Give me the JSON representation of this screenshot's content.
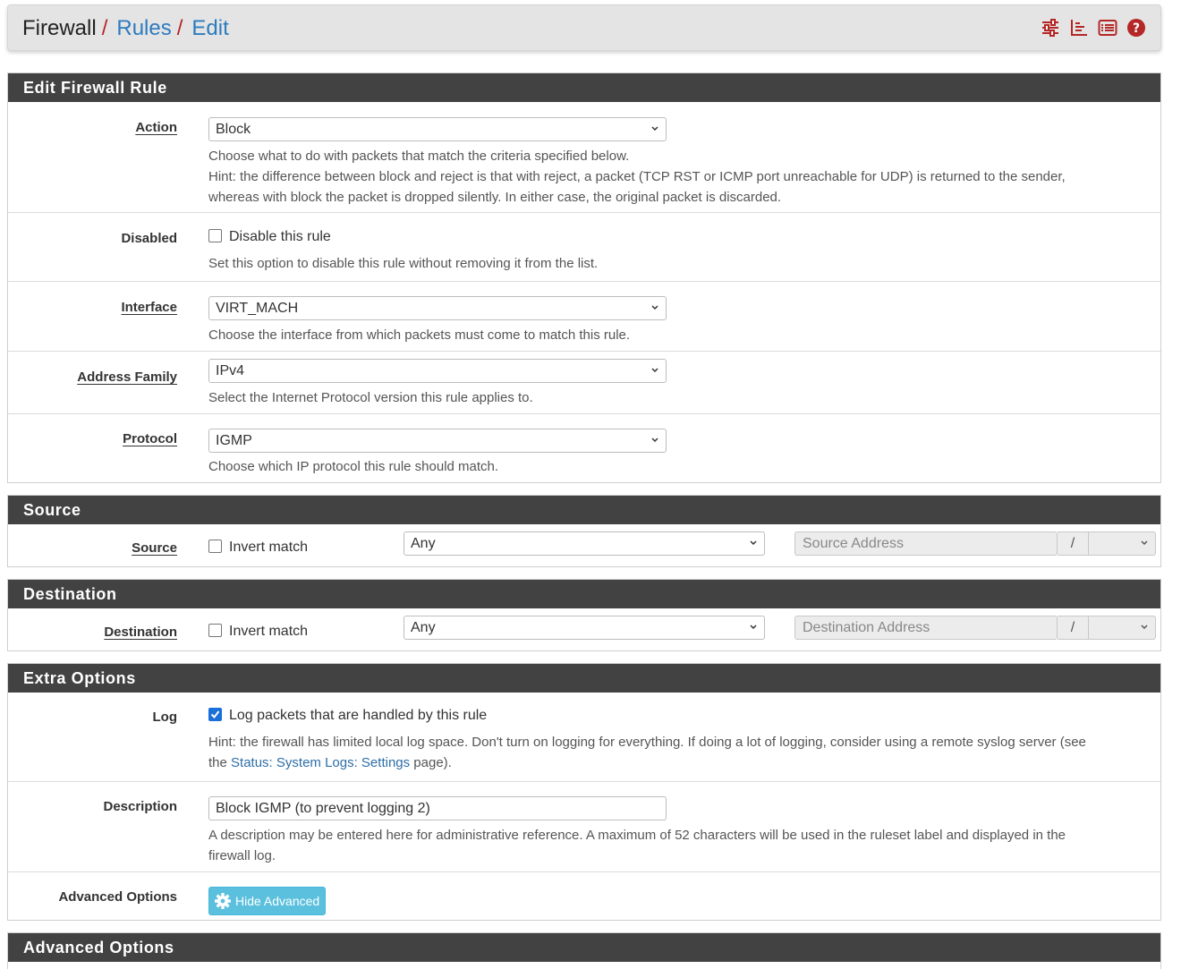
{
  "breadcrumb": {
    "root": "Firewall",
    "sep": "/",
    "level2": "Rules",
    "level3": "Edit"
  },
  "header_icons": [
    "sliders-icon",
    "chart-icon",
    "list-icon",
    "help-icon"
  ],
  "colors": {
    "accent_red": "#b52626",
    "link_blue": "#2d7bbf",
    "panel_head": "#424242",
    "button_info": "#5bc0de",
    "checkbox_on": "#1a6fd8"
  },
  "edit_panel": {
    "title": "Edit Firewall Rule",
    "action": {
      "label": "Action",
      "value": "Block",
      "help1": "Choose what to do with packets that match the criteria specified below.",
      "help2": "Hint: the difference between block and reject is that with reject, a packet (TCP RST or ICMP port unreachable for UDP) is returned to the sender,",
      "help3": "whereas with block the packet is dropped silently. In either case, the original packet is discarded."
    },
    "disabled": {
      "label": "Disabled",
      "checkbox_label": "Disable this rule",
      "checked": false,
      "help": "Set this option to disable this rule without removing it from the list."
    },
    "interface": {
      "label": "Interface",
      "value": "VIRT_MACH",
      "help": "Choose the interface from which packets must come to match this rule."
    },
    "address_family": {
      "label": "Address Family",
      "value": "IPv4",
      "help": "Select the Internet Protocol version this rule applies to."
    },
    "protocol": {
      "label": "Protocol",
      "value": "IGMP",
      "help": "Choose which IP protocol this rule should match."
    }
  },
  "source_panel": {
    "title": "Source",
    "label": "Source",
    "invert_label": "Invert match",
    "invert_checked": false,
    "type_value": "Any",
    "address_placeholder": "Source Address",
    "slash": "/"
  },
  "destination_panel": {
    "title": "Destination",
    "label": "Destination",
    "invert_label": "Invert match",
    "invert_checked": false,
    "type_value": "Any",
    "address_placeholder": "Destination Address",
    "slash": "/"
  },
  "extra_panel": {
    "title": "Extra Options",
    "log": {
      "label": "Log",
      "checkbox_label": "Log packets that are handled by this rule",
      "checked": true,
      "help1": "Hint: the firewall has limited local log space. Don't turn on logging for everything. If doing a lot of logging, consider using a remote syslog server (see",
      "help2_pre": "the ",
      "help2_link": "Status: System Logs: Settings",
      "help2_post": " page)."
    },
    "description": {
      "label": "Description",
      "value": "Block IGMP (to prevent logging 2)",
      "help1": "A description may be entered here for administrative reference. A maximum of 52 characters will be used in the ruleset label and displayed in the",
      "help2": "firewall log."
    },
    "advanced": {
      "label": "Advanced Options",
      "button_label": "Hide Advanced"
    }
  },
  "advanced_panel": {
    "title": "Advanced Options"
  }
}
